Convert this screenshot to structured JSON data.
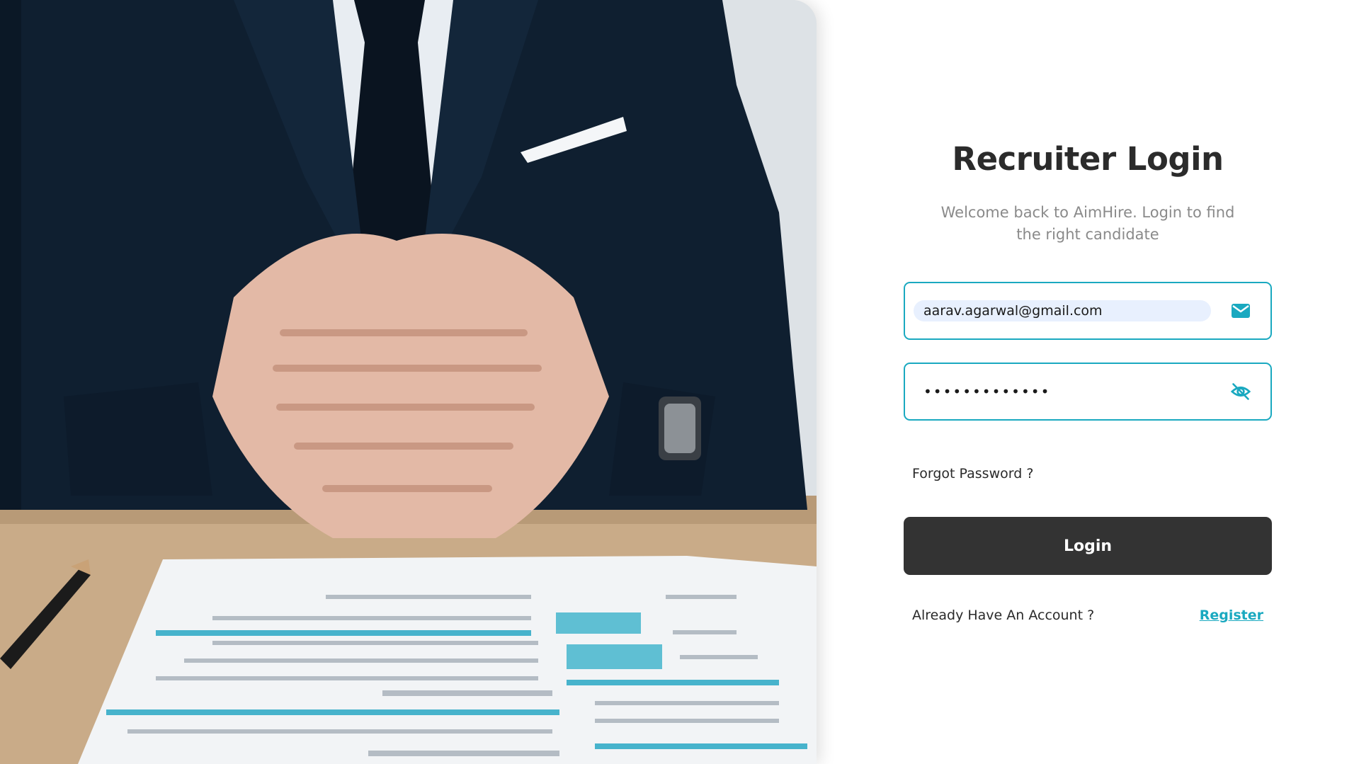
{
  "hero": {
    "image_description": "photo-recruiter-hands-clasped-over-resume",
    "colors": {
      "suit": "#0f1f30",
      "desk": "#c9ab88",
      "paper": "#f2f4f6",
      "accent": "#47b3cc"
    }
  },
  "login": {
    "title": "Recruiter Login",
    "subtitle": "Welcome back to AimHire. Login to find the right candidate",
    "email": {
      "value": "aarav.agarwal@gmail.com",
      "icon": "envelope-icon"
    },
    "password": {
      "value": "•••••••••••••",
      "icon": "eye-slash-icon"
    },
    "forgot_label": "Forgot Password ?",
    "login_button_label": "Login",
    "account_text": "Already Have An Account ?",
    "register_label": "Register"
  },
  "colors": {
    "accent": "#1aa9c0",
    "button": "#333333",
    "title": "#2b2b2b",
    "muted": "#8a8a8a"
  }
}
